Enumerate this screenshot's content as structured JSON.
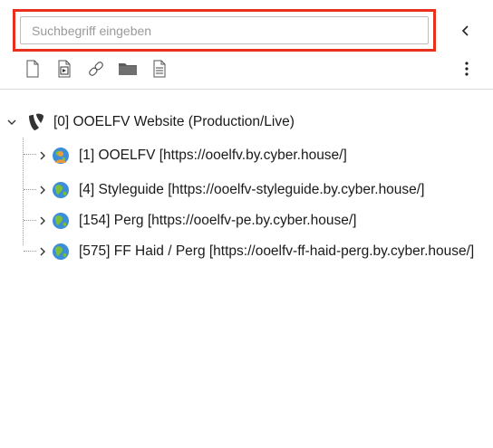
{
  "search": {
    "placeholder": "Suchbegriff eingeben",
    "value": ""
  },
  "toolbar": {
    "icons": [
      "new-page-icon",
      "new-page-template-icon",
      "link-icon",
      "folder-icon",
      "clipboard-icon"
    ],
    "collapse_icon": "chevron-left-icon",
    "more_icon": "more-vertical-icon"
  },
  "tree": {
    "root": {
      "id": "0",
      "label": "[0] OOELFV Website (Production/Live)",
      "icon": "typo3-logo-icon",
      "expanded": true
    },
    "children": [
      {
        "id": "1",
        "label": "[1] OOELFV [https://ooelfv.by.cyber.house/]",
        "icon": "site-globe-user-icon"
      },
      {
        "id": "4",
        "label": "[4] Styleguide [https://ooelfv-styleguide.by.cyber.house/]",
        "icon": "site-globe-icon"
      },
      {
        "id": "154",
        "label": "[154] Perg [https://ooelfv-pe.by.cyber.house/]",
        "icon": "site-globe-icon"
      },
      {
        "id": "575",
        "label": "[575] FF Haid / Perg [https://ooelfv-ff-haid-perg.by.cyber.house/]",
        "icon": "site-globe-icon"
      }
    ]
  },
  "colors": {
    "highlight": "#e8301c",
    "typo3": "#333333",
    "globe_blue": "#3c8ed8",
    "globe_green": "#7cbf3a",
    "user_orange": "#e89a3c"
  }
}
